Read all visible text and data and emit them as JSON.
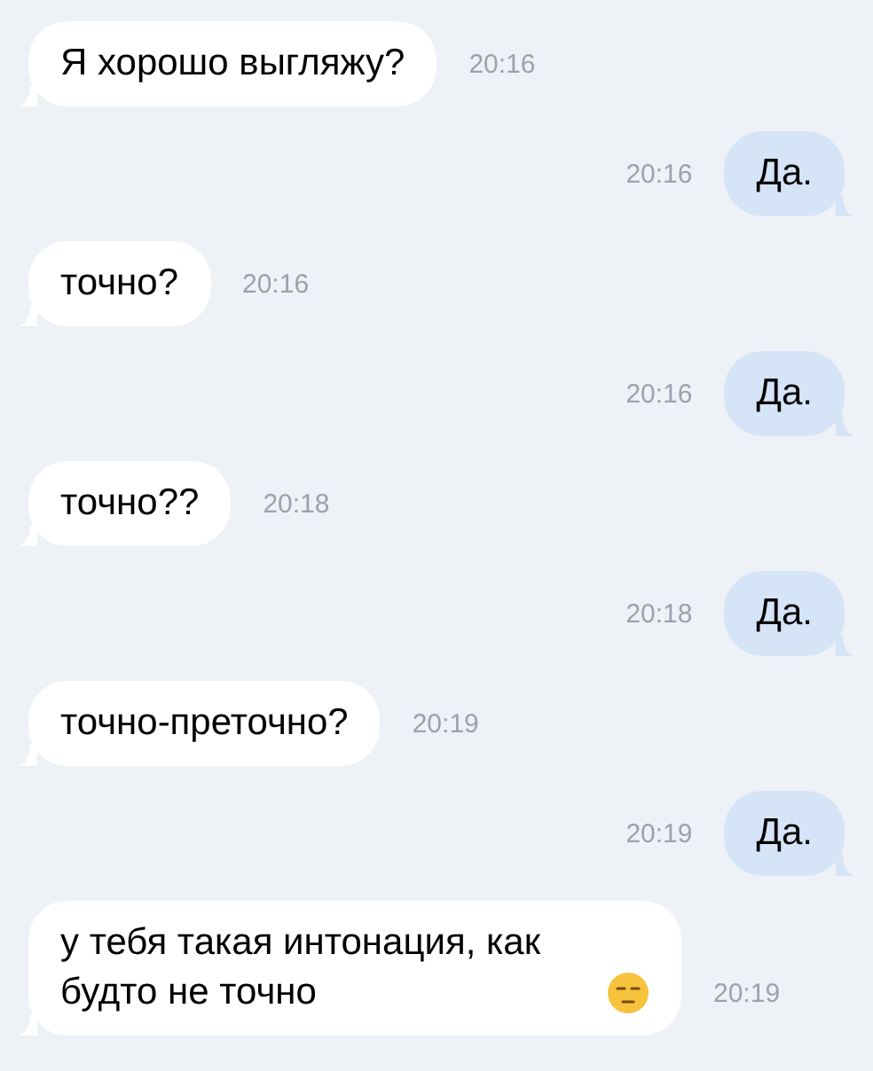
{
  "messages": [
    {
      "outgoing": false,
      "text": "Я хорошо выгляжу?",
      "time": "20:16"
    },
    {
      "outgoing": true,
      "text": "Да.",
      "time": "20:16"
    },
    {
      "outgoing": false,
      "text": "точно?",
      "time": "20:16"
    },
    {
      "outgoing": true,
      "text": "Да.",
      "time": "20:16"
    },
    {
      "outgoing": false,
      "text": "точно??",
      "time": "20:18"
    },
    {
      "outgoing": true,
      "text": "Да.",
      "time": "20:18"
    },
    {
      "outgoing": false,
      "text": "точно-преточно?",
      "time": "20:19"
    },
    {
      "outgoing": true,
      "text": "Да.",
      "time": "20:19"
    },
    {
      "outgoing": false,
      "text": "у тебя такая интонация, как будто не точно",
      "time": "20:19",
      "has_emoji": true
    }
  ]
}
